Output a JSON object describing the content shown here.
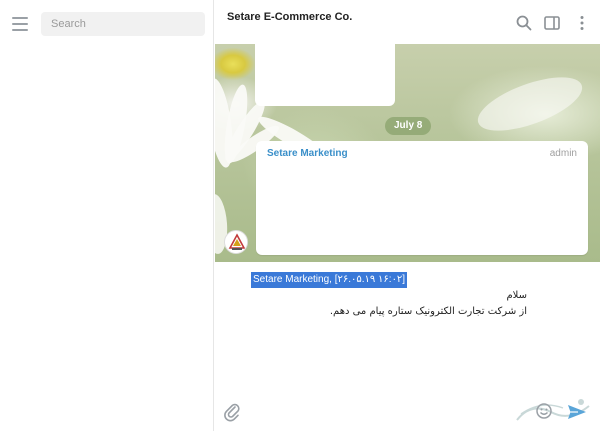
{
  "sidebar": {
    "search": {
      "placeholder": "Search",
      "value": ""
    }
  },
  "header": {
    "title": "Setare E-Commerce Co.",
    "icons": [
      "search-icon",
      "sidebar-toggle-icon",
      "more-vertical-icon"
    ]
  },
  "chat": {
    "date_divider": "July 8",
    "message": {
      "sender": "Setare Marketing",
      "role": "admin"
    }
  },
  "composer": {
    "quoted_header": "Setare Marketing, [۲۶.۰۵.۱۹ ۱۶:۰۲]",
    "line1": "سلام",
    "line2": "از شرکت تجارت الکترونیک ستاره پیام می دهم."
  },
  "colors": {
    "accent": "#3a8fc9",
    "selection": "#3a79d8",
    "date_pill": "#7c9a5a"
  }
}
